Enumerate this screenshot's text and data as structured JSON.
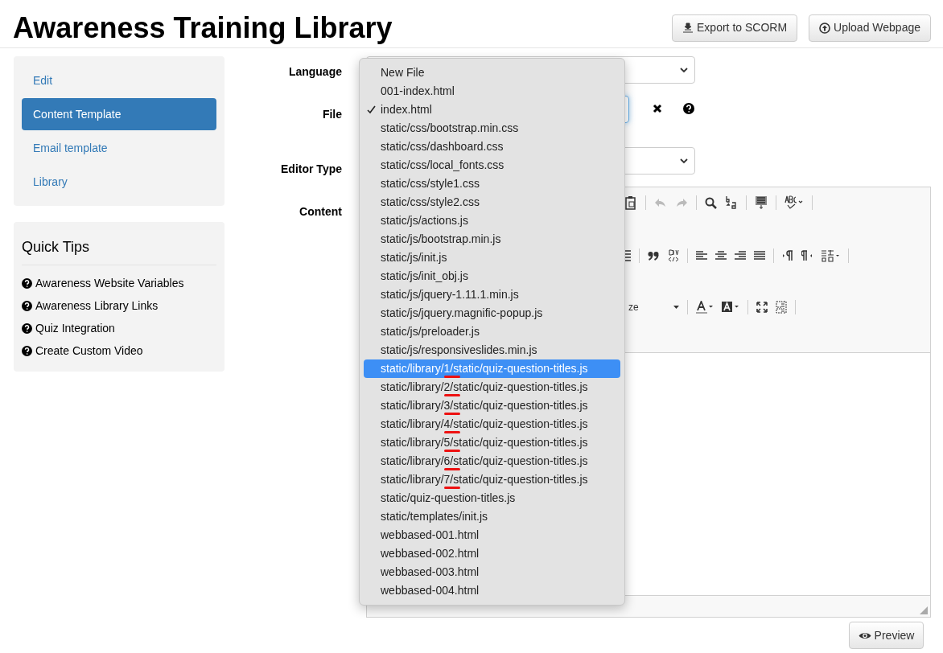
{
  "page_title": "Awareness Training Library",
  "header_buttons": [
    {
      "kind": "export",
      "label": "Export to SCORM"
    },
    {
      "kind": "upload",
      "label": "Upload Webpage"
    }
  ],
  "sidebar": {
    "items": [
      {
        "label": "Edit",
        "selected": false
      },
      {
        "label": "Content Template",
        "selected": true
      },
      {
        "label": "Email template",
        "selected": false
      },
      {
        "label": "Library",
        "selected": false
      }
    ]
  },
  "quick_tips": {
    "title": "Quick Tips",
    "links": [
      "Awareness Website Variables",
      "Awareness Library Links",
      "Quiz Integration",
      "Create Custom Video"
    ]
  },
  "form": {
    "labels": {
      "language": "Language",
      "file": "File",
      "editor_type": "Editor Type",
      "content": "Content"
    },
    "toolbar_combo_label": "ze"
  },
  "file_dropdown": {
    "items": [
      {
        "label": "New File",
        "checked": false,
        "selected": false,
        "marked": false
      },
      {
        "label": "001-index.html",
        "checked": false,
        "selected": false,
        "marked": false
      },
      {
        "label": "index.html",
        "checked": true,
        "selected": false,
        "marked": false
      },
      {
        "label": "static/css/bootstrap.min.css",
        "checked": false,
        "selected": false,
        "marked": false
      },
      {
        "label": "static/css/dashboard.css",
        "checked": false,
        "selected": false,
        "marked": false
      },
      {
        "label": "static/css/local_fonts.css",
        "checked": false,
        "selected": false,
        "marked": false
      },
      {
        "label": "static/css/style1.css",
        "checked": false,
        "selected": false,
        "marked": false
      },
      {
        "label": "static/css/style2.css",
        "checked": false,
        "selected": false,
        "marked": false
      },
      {
        "label": "static/js/actions.js",
        "checked": false,
        "selected": false,
        "marked": false
      },
      {
        "label": "static/js/bootstrap.min.js",
        "checked": false,
        "selected": false,
        "marked": false
      },
      {
        "label": "static/js/init.js",
        "checked": false,
        "selected": false,
        "marked": false
      },
      {
        "label": "static/js/init_obj.js",
        "checked": false,
        "selected": false,
        "marked": false
      },
      {
        "label": "static/js/jquery-1.11.1.min.js",
        "checked": false,
        "selected": false,
        "marked": false
      },
      {
        "label": "static/js/jquery.magnific-popup.js",
        "checked": false,
        "selected": false,
        "marked": false
      },
      {
        "label": "static/js/preloader.js",
        "checked": false,
        "selected": false,
        "marked": false
      },
      {
        "label": "static/js/responsiveslides.min.js",
        "checked": false,
        "selected": false,
        "marked": false
      },
      {
        "label": "static/library/1/static/quiz-question-titles.js",
        "checked": false,
        "selected": true,
        "marked": true
      },
      {
        "label": "static/library/2/static/quiz-question-titles.js",
        "checked": false,
        "selected": false,
        "marked": true
      },
      {
        "label": "static/library/3/static/quiz-question-titles.js",
        "checked": false,
        "selected": false,
        "marked": true
      },
      {
        "label": "static/library/4/static/quiz-question-titles.js",
        "checked": false,
        "selected": false,
        "marked": true
      },
      {
        "label": "static/library/5/static/quiz-question-titles.js",
        "checked": false,
        "selected": false,
        "marked": true
      },
      {
        "label": "static/library/6/static/quiz-question-titles.js",
        "checked": false,
        "selected": false,
        "marked": true
      },
      {
        "label": "static/library/7/static/quiz-question-titles.js",
        "checked": false,
        "selected": false,
        "marked": true
      },
      {
        "label": "static/quiz-question-titles.js",
        "checked": false,
        "selected": false,
        "marked": false
      },
      {
        "label": "static/templates/init.js",
        "checked": false,
        "selected": false,
        "marked": false
      },
      {
        "label": "webbased-001.html",
        "checked": false,
        "selected": false,
        "marked": false
      },
      {
        "label": "webbased-002.html",
        "checked": false,
        "selected": false,
        "marked": false
      },
      {
        "label": "webbased-003.html",
        "checked": false,
        "selected": false,
        "marked": false
      },
      {
        "label": "webbased-004.html",
        "checked": false,
        "selected": false,
        "marked": false
      }
    ]
  },
  "preview_button": {
    "label": "Preview"
  }
}
